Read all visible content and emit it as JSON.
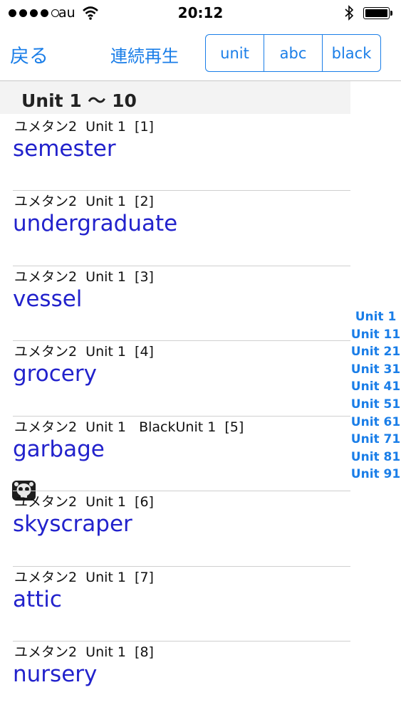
{
  "status_bar": {
    "carrier": "au",
    "time": "20:12",
    "signal_bars": 4,
    "signal_total": 5,
    "battery_level": 1.0
  },
  "nav": {
    "back_label": "戻る",
    "play_label": "連続再生",
    "segments": [
      "unit",
      "abc",
      "black"
    ]
  },
  "section_title": "Unit 1 〜 10",
  "entries": [
    {
      "meta": "ユメタン2  Unit 1  [1]",
      "word": "semester"
    },
    {
      "meta": "ユメタン2  Unit 1  [2]",
      "word": "undergraduate"
    },
    {
      "meta": "ユメタン2  Unit 1  [3]",
      "word": "vessel"
    },
    {
      "meta": "ユメタン2  Unit 1  [4]",
      "word": "grocery"
    },
    {
      "meta": "ユメタン2  Unit 1   BlackUnit 1  [5]",
      "word": "garbage",
      "icon": "skull-icon"
    },
    {
      "meta": "ユメタン2  Unit 1  [6]",
      "word": "skyscraper"
    },
    {
      "meta": "ユメタン2  Unit 1  [7]",
      "word": "attic"
    },
    {
      "meta": "ユメタン2  Unit 1  [8]",
      "word": "nursery"
    }
  ],
  "index": [
    "Unit 1",
    "Unit 11",
    "Unit 21",
    "Unit 31",
    "Unit 41",
    "Unit 51",
    "Unit 61",
    "Unit 71",
    "Unit 81",
    "Unit 91"
  ],
  "colors": {
    "accent": "#1a7ee8",
    "word": "#2222cc"
  }
}
